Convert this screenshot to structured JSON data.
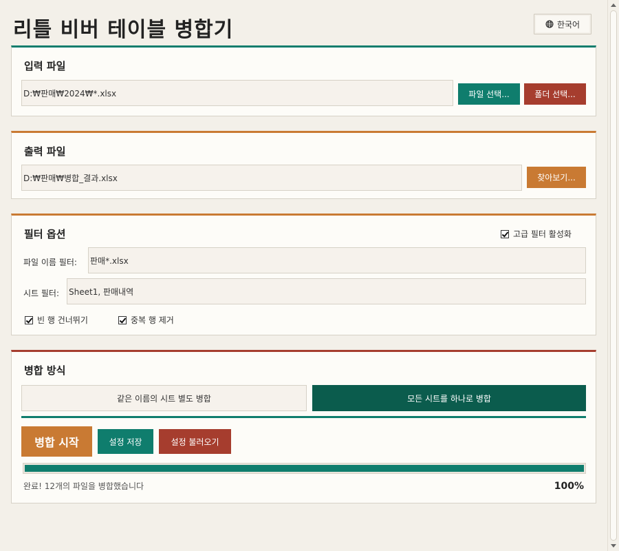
{
  "app": {
    "title": "리틀 비버 테이블 병합기",
    "language_label": "한국어"
  },
  "input_section": {
    "title": "입력 파일",
    "path_value": "D:₩판매₩2024₩*.xlsx",
    "select_files_label": "파일 선택...",
    "select_folder_label": "폴더 선택..."
  },
  "output_section": {
    "title": "출력 파일",
    "path_value": "D:₩판매₩병합_결과.xlsx",
    "browse_label": "찾아보기..."
  },
  "filter_section": {
    "title": "필터 옵션",
    "advanced_label": "고급 필터 활성화",
    "advanced_checked": true,
    "filename_filter_label": "파일 이름 필터:",
    "filename_filter_value": "판매*.xlsx",
    "sheet_filter_label": "시트 필터:",
    "sheet_filter_value": "Sheet1, 판매내역",
    "skip_empty_label": "빈 행 건너뛰기",
    "skip_empty_checked": true,
    "dedupe_label": "중복 행 제거",
    "dedupe_checked": true
  },
  "merge_section": {
    "title": "병합 방식",
    "mode_by_name_label": "같은 이름의 시트 별도 병합",
    "mode_all_label": "모든 시트를 하나로 병합",
    "selected_mode": "all",
    "start_label": "병합 시작",
    "save_settings_label": "설정 저장",
    "load_settings_label": "설정 불러오기",
    "progress": 1.0,
    "progress_text": "100%",
    "status_text": "완료! 12개의 파일을 병합했습니다"
  },
  "colors": {
    "teal": "#0f7d6d",
    "dark_teal": "#0b5c4d",
    "rust": "#a63d2e",
    "orange": "#c97a33"
  }
}
